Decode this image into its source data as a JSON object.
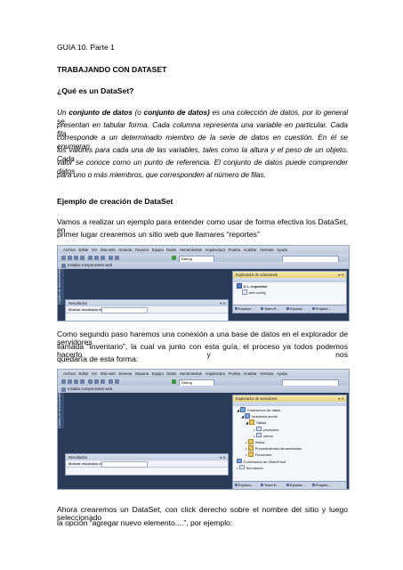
{
  "doc": {
    "heading": "GUIA 10. Parte 1",
    "section_title": "TRABAJANDO CON DATASET",
    "question": "¿Qué es un DataSet?",
    "definition_lines": [
      [
        "Un ",
        "conjunto de datos",
        " (o ",
        "conjunto de datos)",
        " es una colección de datos, por lo general se"
      ],
      "presentan   en tabular forma. Cada columna representa   una   variable   en   particular. Cada fila",
      "corresponde a un determinado miembro de la serie de datos en cuestión. En él se enumeran",
      "los valores para cada una de las variables, tales como la altura y el peso de un objeto. Cada",
      "valor se conoce como un punto de referencia. El conjunto de datos puede comprender datos",
      "para uno o más miembros, que corresponden al número de filas."
    ],
    "example_title": "Ejemplo de creación de DataSet",
    "paragraph1": [
      "Vamos a realizar un ejemplo para entender como usar de forma efectiva los DataSet, en",
      "primer lugar crearemos un sitio web que llamares “reportes”"
    ],
    "paragraph2": [
      "Como segundo paso haremos una conexión a una base de datos en el explorador de servidores",
      "llamada “inventario”, la cual va junto con esta guía, el proceso ya todos podemos hacerlo y nos",
      "quedaría de esta forma:"
    ],
    "paragraph3": [
      "Ahora crearemos un DataSet, con click derecho sobre el nombre del sitio y luego seleccionado",
      "la opción “agregar nuevo elemento....”, por ejemplo:"
    ]
  },
  "ide": {
    "menu": [
      "Archivo",
      "Editar",
      "Ver",
      "Sitio web",
      "Generar",
      "Depurar",
      "Equipo",
      "Datos",
      "Herramientas",
      "Arquitectura",
      "Prueba",
      "Analizar",
      "Ventana",
      "Ayuda"
    ],
    "config": "Debug",
    "install_label": "Instalar componentes web",
    "toolbox_tab": "Cuadro de herramientas",
    "results_title": "Resultados",
    "results_show": "Mostrar resultados desde:",
    "bottom_tabs1": [
      "Explora...",
      "Team E...",
      "Explora...",
      "Propied..."
    ],
    "bottom_tabs2": [
      "Explora...",
      "Team E...",
      "Explora...",
      "Propied..."
    ]
  },
  "shot1": {
    "panel_title": "Explorador de soluciones",
    "items": [
      "C:\\...\\reportes\\",
      "web.config"
    ]
  },
  "shot2": {
    "panel_title": "Explorador de servidores",
    "items": [
      "Conexiones de datos",
      "inventario.accdb",
      "Tablas",
      "productos",
      "rubros",
      "Vistas",
      "Procedimientos almacenados",
      "Funciones",
      "Conexiones de SharePoint",
      "Servidores"
    ]
  },
  "colors": {
    "ide_bg": "#2b3c59",
    "panel_head": "#e7cf77"
  }
}
